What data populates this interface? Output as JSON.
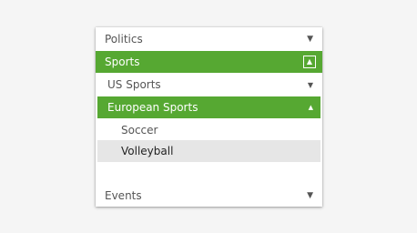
{
  "menu": {
    "politics": {
      "label": "Politics",
      "icon": "chevron-down-icon"
    },
    "sports": {
      "label": "Sports",
      "icon": "collapse-box-icon"
    },
    "us_sports": {
      "label": "US Sports",
      "icon": "chevron-down-icon"
    },
    "european_sports": {
      "label": "European Sports",
      "icon": "chevron-up-icon"
    },
    "soccer": {
      "label": "Soccer"
    },
    "volleyball": {
      "label": "Volleyball"
    },
    "events": {
      "label": "Events",
      "icon": "chevron-down-icon"
    }
  },
  "colors": {
    "accent": "#56a832",
    "selected_bg": "#e6e6e6"
  }
}
